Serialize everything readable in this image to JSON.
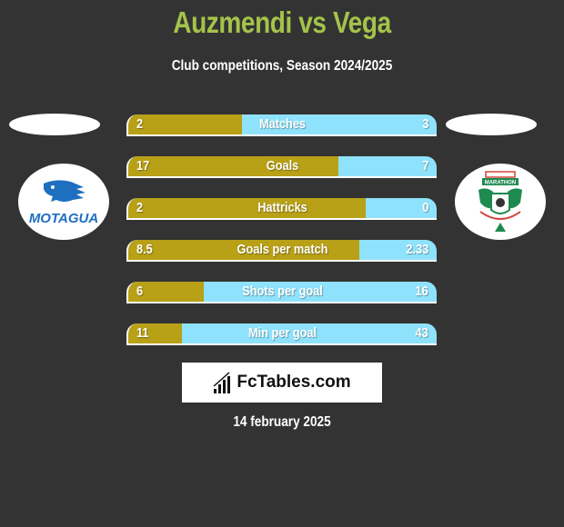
{
  "header": {
    "title": "Auzmendi vs Vega",
    "subtitle": "Club competitions, Season 2024/2025"
  },
  "teams": {
    "left": {
      "name": "Motagua",
      "logo_text": "MOTAGUA"
    },
    "right": {
      "name": "Marathon",
      "logo_text": "MARATHON"
    }
  },
  "colors": {
    "left_fill": "#b8a017",
    "right_fill": "#8fe2fb",
    "title": "#a4c34a",
    "background": "#333333"
  },
  "stats": [
    {
      "label": "Matches",
      "left": "2",
      "right": "3",
      "left_fraction": 0.37
    },
    {
      "label": "Goals",
      "left": "17",
      "right": "7",
      "left_fraction": 0.68
    },
    {
      "label": "Hattricks",
      "left": "2",
      "right": "0",
      "left_fraction": 0.77
    },
    {
      "label": "Goals per match",
      "left": "8.5",
      "right": "2.33",
      "left_fraction": 0.75
    },
    {
      "label": "Shots per goal",
      "left": "6",
      "right": "16",
      "left_fraction": 0.245
    },
    {
      "label": "Min per goal",
      "left": "11",
      "right": "43",
      "left_fraction": 0.175
    }
  ],
  "footer": {
    "brand": "FcTables.com",
    "brand_icon": "bar-chart-icon",
    "date": "14 february 2025"
  }
}
